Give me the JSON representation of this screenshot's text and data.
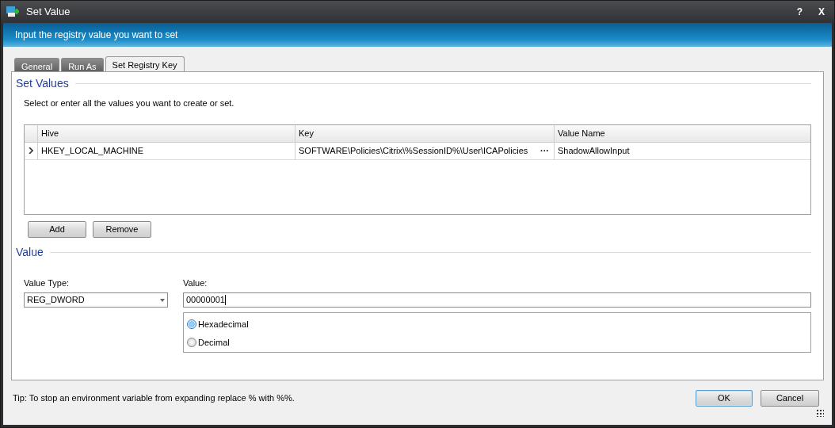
{
  "window": {
    "title": "Set Value",
    "help": "?",
    "close": "X"
  },
  "banner": "Input the registry value you want to set",
  "tabs": [
    {
      "label": "General",
      "selected": false
    },
    {
      "label": "Run As",
      "selected": false
    },
    {
      "label": "Set Registry Key",
      "selected": true
    }
  ],
  "set_values": {
    "heading": "Set Values",
    "instruction": "Select or enter all the values you want to create or set.",
    "grid": {
      "columns": [
        "Hive",
        "Key",
        "Value Name"
      ],
      "rows": [
        {
          "current": true,
          "cells": [
            "HKEY_LOCAL_MACHINE",
            "SOFTWARE\\Policies\\Citrix\\%SessionID%\\User\\ICAPolicies",
            "ShadowAllowInput"
          ],
          "browse": "···"
        }
      ]
    },
    "buttons": [
      "Add",
      "Remove"
    ]
  },
  "value": {
    "heading": "Value",
    "value_type": {
      "label": "Value Type:",
      "value": "REG_DWORD"
    },
    "value_field": {
      "label": "Value:",
      "value": "00000001"
    },
    "radios": [
      {
        "label": "Hexadecimal",
        "selected": true
      },
      {
        "label": "Decimal",
        "selected": false
      }
    ]
  },
  "tip": "Tip: To stop an environment variable from expanding replace % with %%.",
  "buttons": [
    {
      "label": "OK",
      "default": true
    },
    {
      "label": "Cancel",
      "default": false
    }
  ]
}
